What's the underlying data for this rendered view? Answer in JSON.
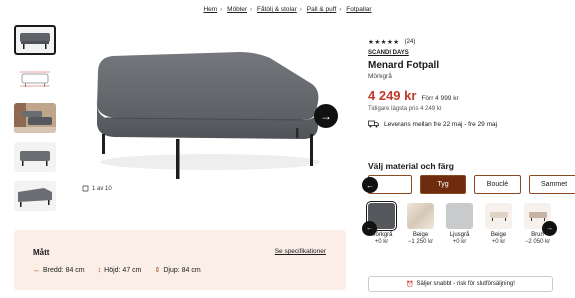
{
  "breadcrumb": [
    "Hem",
    "Möbler",
    "Fåtölj & stolar",
    "Pall & puff",
    "Fotpallar"
  ],
  "gallery": {
    "counter": "1 av 10",
    "thumbnails": [
      "ottoman-grey",
      "ottoman-sketch",
      "living-room",
      "ottoman-front",
      "ottoman-side"
    ]
  },
  "size": {
    "title": "Mått",
    "spec_link": "Se specifikationer",
    "width": "Bredd: 84 cm",
    "height": "Höjd: 47 cm",
    "depth": "Djup: 84 cm"
  },
  "product": {
    "stars": "★★★★★",
    "rating_count": "(24)",
    "brand": "SCANDI DAYS",
    "name": "Menard Fotpall",
    "color": "Mörkgrå",
    "price": "4 249 kr",
    "before_price": "Förr 4 999 kr",
    "lowest_price": "Tidigare lägsta pris 4 249 kr",
    "delivery": "Leverans mellan fre 22 maj - fre 29 maj"
  },
  "material": {
    "title": "Välj material och färg",
    "tabs": [
      "",
      "Tyg",
      "Bouclé",
      "Sammet"
    ],
    "active_tab": 1,
    "swatches": [
      {
        "name": "Mörkgrå",
        "price": "+0 kr",
        "color": "#55585c",
        "selected": true
      },
      {
        "name": "Beige",
        "price": "−1 250 kr",
        "color": "#e2d6c6"
      },
      {
        "name": "Ljusgrå",
        "price": "+0 kr",
        "color": "#c9cacc"
      },
      {
        "name": "Beige",
        "price": "+0 kr",
        "color": "#e8dcd0"
      },
      {
        "name": "Brun",
        "price": "−2 050 kr",
        "color": "#8a6a58"
      }
    ]
  },
  "badge": {
    "text": "Säljer snabbt - risk för slutförsäljning!"
  },
  "colors": {
    "accent": "#6e2b0e",
    "price": "#c0392b",
    "panel": "#fbeee6"
  }
}
